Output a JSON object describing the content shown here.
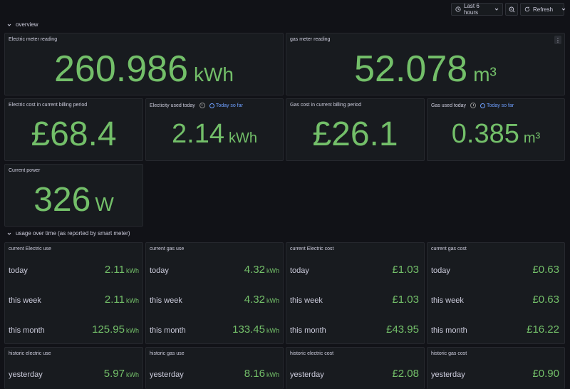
{
  "toolbar": {
    "time_range": "Last 6 hours",
    "refresh": "Refresh"
  },
  "rows": {
    "overview": "overview",
    "usage": "usage over time (as reported by smart meter)"
  },
  "panels": {
    "electric_meter": {
      "title": "Electric meter reading",
      "value": "260.986",
      "unit": "kWh"
    },
    "gas_meter": {
      "title": "gas meter reading",
      "value": "52.078",
      "unit": "m³"
    },
    "electric_cost": {
      "title": "Electric cost in current billing period",
      "value": "£68.4"
    },
    "electricity_today": {
      "title": "Electicity used today",
      "badge": "Today so far",
      "value": "2.14",
      "unit": "kWh"
    },
    "gas_cost": {
      "title": "Gas cost in current billing period",
      "value": "£26.1"
    },
    "gas_today": {
      "title": "Gas used today",
      "badge": "Today so far",
      "value": "0.385",
      "unit": "m³"
    },
    "current_power": {
      "title": "Current power",
      "value": "326",
      "unit": "W"
    }
  },
  "usage_panels": [
    {
      "title": "current Electric use",
      "rows": [
        {
          "label": "today",
          "value": "2.11",
          "unit": "kWh"
        },
        {
          "label": "this week",
          "value": "2.11",
          "unit": "kWh"
        },
        {
          "label": "this month",
          "value": "125.95",
          "unit": "kWh"
        }
      ]
    },
    {
      "title": "current gas use",
      "rows": [
        {
          "label": "today",
          "value": "4.32",
          "unit": "kWh"
        },
        {
          "label": "this week",
          "value": "4.32",
          "unit": "kWh"
        },
        {
          "label": "this month",
          "value": "133.45",
          "unit": "kWh"
        }
      ]
    },
    {
      "title": "current Electric cost",
      "rows": [
        {
          "label": "today",
          "value": "£1.03",
          "unit": ""
        },
        {
          "label": "this week",
          "value": "£1.03",
          "unit": ""
        },
        {
          "label": "this month",
          "value": "£43.95",
          "unit": ""
        }
      ]
    },
    {
      "title": "current gas cost",
      "rows": [
        {
          "label": "today",
          "value": "£0.63",
          "unit": ""
        },
        {
          "label": "this week",
          "value": "£0.63",
          "unit": ""
        },
        {
          "label": "this month",
          "value": "£16.22",
          "unit": ""
        }
      ]
    }
  ],
  "historic_panels": [
    {
      "title": "historic electric use",
      "label": "yesterday",
      "value": "5.97",
      "unit": "kWh"
    },
    {
      "title": "historic gas use",
      "label": "yesterday",
      "value": "8.16",
      "unit": "kWh"
    },
    {
      "title": "historic electric cost",
      "label": "yesterday",
      "value": "£2.08",
      "unit": ""
    },
    {
      "title": "historic gas cost",
      "label": "yesterday",
      "value": "£0.90",
      "unit": ""
    }
  ],
  "colors": {
    "background": "#111217",
    "panel": "#181b1f",
    "value_green": "#73bf69",
    "badge_blue": "#6e9fff"
  }
}
